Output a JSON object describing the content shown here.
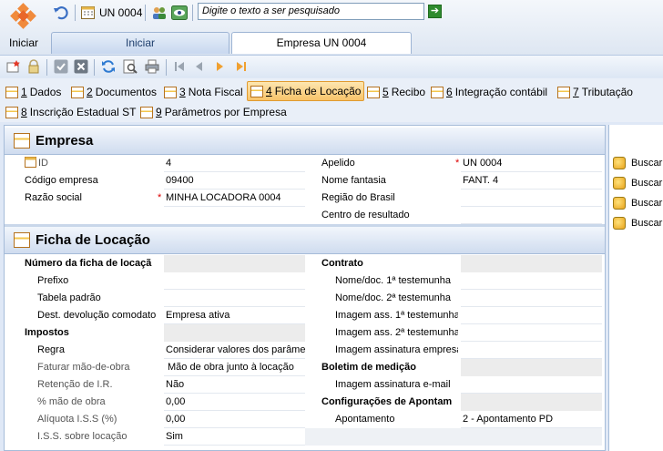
{
  "app": {
    "start_label": "Iniciar",
    "unit_label": "UN 0004",
    "search_placeholder": "Digite o texto a ser pesquisado"
  },
  "tabs": [
    {
      "label": "Iniciar"
    },
    {
      "label": "Empresa UN 0004"
    }
  ],
  "subtabs": [
    {
      "num": "1",
      "label": "Dados"
    },
    {
      "num": "2",
      "label": "Documentos"
    },
    {
      "num": "3",
      "label": "Nota Fiscal"
    },
    {
      "num": "4",
      "label": "Ficha de Locação"
    },
    {
      "num": "5",
      "label": "Recibo"
    },
    {
      "num": "6",
      "label": "Integração contábil"
    },
    {
      "num": "7",
      "label": "Tributação"
    },
    {
      "num": "8",
      "label": "Inscrição Estadual ST"
    },
    {
      "num": "9",
      "label": "Parâmetros por Empresa"
    }
  ],
  "empresa": {
    "title": "Empresa",
    "id_label": "ID",
    "id_value": "4",
    "codigo_label": "Código empresa",
    "codigo_value": "09400",
    "razao_label": "Razão social",
    "razao_value": "MINHA LOCADORA 0004",
    "apelido_label": "Apelido",
    "apelido_value": "UN 0004",
    "fantasia_label": "Nome fantasia",
    "fantasia_value": "FANT. 4",
    "regiao_label": "Região do Brasil",
    "regiao_value": "",
    "centro_label": "Centro de resultado",
    "centro_value": ""
  },
  "ficha": {
    "title": "Ficha de Locação",
    "numero_label": "Número da ficha de locaçã",
    "prefixo_label": "Prefixo",
    "prefixo_value": "",
    "tabela_label": "Tabela padrão",
    "tabela_value": "",
    "dest_label": "Dest. devolução comodato",
    "dest_value": "Empresa ativa",
    "impostos_label": "Impostos",
    "regra_label": "Regra",
    "regra_value": "Considerar valores dos parâme",
    "faturar_label": "Faturar mão-de-obra",
    "faturar_value": "Mão de obra junto à locação",
    "retencao_label": "Retenção de I.R.",
    "retencao_value": "Não",
    "maodeobra_label": "% mão de obra",
    "maodeobra_value": "0,00",
    "aliquota_label": "Alíquota I.S.S (%)",
    "aliquota_value": "0,00",
    "iss_label": "I.S.S. sobre locação",
    "iss_value": "Sim",
    "contrato_label": "Contrato",
    "test1_label": "Nome/doc. 1ª testemunha",
    "test2_label": "Nome/doc. 2ª testemunha",
    "img1_label": "Imagem ass. 1ª testemunha",
    "img2_label": "Imagem ass. 2ª testemunha",
    "imgemp_label": "Imagem assinatura empresa",
    "boletim_label": "Boletim de medição",
    "imgemail_label": "Imagem assinatura e-mail",
    "config_label": "Configurações de Apontam",
    "apont_label": "Apontamento",
    "apont_value": "2 - Apontamento PD"
  },
  "side": {
    "buscar": [
      "Buscar",
      "Buscar",
      "Buscar",
      "Buscar"
    ]
  },
  "colors": {
    "accent": "#f08a3c",
    "required": "#dd0000",
    "active_tab": "#f8c46a"
  }
}
